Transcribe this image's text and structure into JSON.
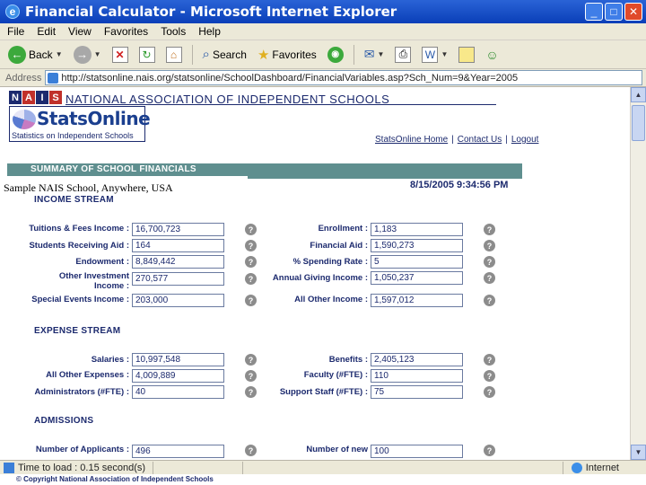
{
  "window": {
    "title": "Financial Calculator - Microsoft Internet Explorer"
  },
  "menu": [
    "File",
    "Edit",
    "View",
    "Favorites",
    "Tools",
    "Help"
  ],
  "toolbar": {
    "back_label": "Back",
    "search_label": "Search",
    "favorites_label": "Favorites"
  },
  "address": {
    "label": "Address",
    "url": "http://statsonline.nais.org/statsonline/SchoolDashboard/FinancialVariables.asp?Sch_Num=9&Year=2005"
  },
  "header": {
    "org_name": "NATIONAL ASSOCIATION OF INDEPENDENT SCHOOLS",
    "logo_letters": [
      "N",
      "A",
      "I",
      "S"
    ],
    "stats_word": "StatsOnline",
    "stats_sub": "Statistics on Independent Schools",
    "links": [
      "StatsOnline Home",
      "Contact Us",
      "Logout"
    ],
    "link_sep": "|"
  },
  "summary": {
    "bar_title": "SUMMARY OF SCHOOL FINANCIALS",
    "school_name": "Sample NAIS School, Anywhere, USA",
    "timestamp": "8/15/2005 9:34:56 PM"
  },
  "income": {
    "title": "INCOME STREAM",
    "left": [
      {
        "label": "Tuitions & Fees Income :",
        "value": "16,700,723"
      },
      {
        "label": "Students Receiving Aid :",
        "value": "164"
      },
      {
        "label": "Endowment :",
        "value": "8,849,442"
      },
      {
        "label": "Other Investment Income :",
        "value": "270,577"
      },
      {
        "label": "Special Events Income :",
        "value": "203,000"
      }
    ],
    "right": [
      {
        "label": "Enrollment :",
        "value": "1,183"
      },
      {
        "label": "Financial Aid :",
        "value": "1,590,273"
      },
      {
        "label": "% Spending Rate :",
        "value": "5"
      },
      {
        "label": "Annual Giving Income :",
        "value": "1,050,237"
      },
      {
        "label": "All Other Income :",
        "value": "1,597,012"
      }
    ]
  },
  "expense": {
    "title": "EXPENSE STREAM",
    "left": [
      {
        "label": "Salaries :",
        "value": "10,997,548"
      },
      {
        "label": "All Other Expenses :",
        "value": "4,009,889"
      },
      {
        "label": "Administrators (#FTE) :",
        "value": "40"
      }
    ],
    "right": [
      {
        "label": "Benefits :",
        "value": "2,405,123"
      },
      {
        "label": "Faculty (#FTE) :",
        "value": "110"
      },
      {
        "label": "Support Staff (#FTE) :",
        "value": "75"
      }
    ]
  },
  "admissions": {
    "title": "ADMISSIONS",
    "left": [
      {
        "label": "Number of Applicants :",
        "value": "496"
      }
    ],
    "right": [
      {
        "label": "Number of new",
        "value": "100"
      }
    ]
  },
  "help_glyph": "?",
  "status": {
    "text": "Time to load : 0.15 second(s)",
    "zone": "Internet"
  },
  "footer": {
    "copyright": "© Copyright National Association of Independent Schools"
  },
  "colors": {
    "title_bar": "#0a3fb8",
    "chrome": "#ece9d8",
    "nais_navy": "#1c2a6e",
    "summary_teal": "#5f8f8f",
    "help_gray": "#8c8c8c"
  }
}
